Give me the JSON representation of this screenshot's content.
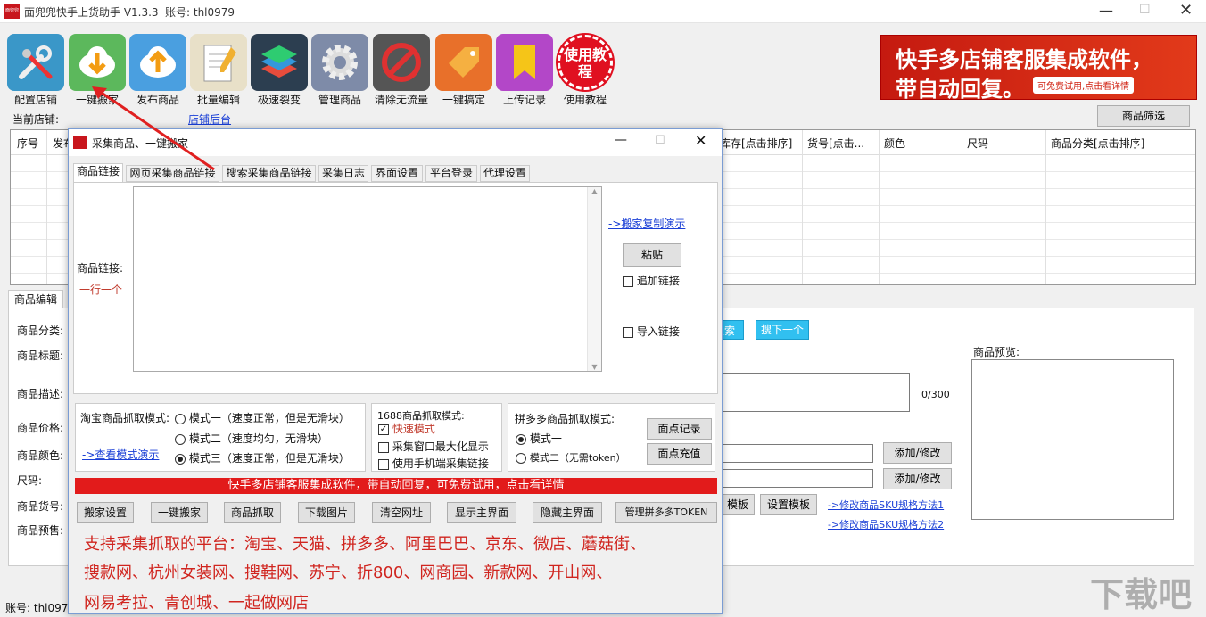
{
  "app": {
    "title": "面兜兜快手上货助手 V1.3.3",
    "account": "账号: thl0979",
    "logo_text": "面兜兜"
  },
  "toolbar": [
    {
      "label": "配置店铺",
      "icon": "tools-icon"
    },
    {
      "label": "一键搬家",
      "icon": "download-cloud-icon"
    },
    {
      "label": "发布商品",
      "icon": "upload-cloud-icon"
    },
    {
      "label": "批量编辑",
      "icon": "notepad-icon"
    },
    {
      "label": "极速裂变",
      "icon": "layers-icon"
    },
    {
      "label": "管理商品",
      "icon": "gear-icon"
    },
    {
      "label": "清除无流量",
      "icon": "forbidden-icon"
    },
    {
      "label": "一键搞定",
      "icon": "tag-icon"
    },
    {
      "label": "上传记录",
      "icon": "bookmark-icon"
    },
    {
      "label": "使用教程",
      "icon": "tutorial-badge-icon",
      "badge": "使用教程"
    }
  ],
  "banner": {
    "line1": "快手多店铺客服集成软件，",
    "line2": "带自动回复。",
    "tag": "可免费试用,点击看详情"
  },
  "main": {
    "current_store_label": "当前店铺:",
    "store_link": "店铺后台",
    "filter_button": "商品筛选",
    "columns_left": [
      "序号",
      "发布"
    ],
    "columns_right": [
      "库存[点击排序]",
      "货号[点击...",
      "颜色",
      "尺码",
      "商品分类[点击排序]"
    ],
    "edit_tab": "商品编辑",
    "fields": [
      "商品分类:",
      "商品标题:",
      "商品描述:",
      "商品价格:",
      "商品颜色:",
      "尺码:",
      "商品货号:",
      "商品预售:"
    ],
    "search_btn": "搜索",
    "next_btn": "搜下一个",
    "counter": "0/300",
    "preview_label": "商品预览:",
    "add_edit_1": "添加/修改",
    "add_edit_2": "添加/修改",
    "template_btn": "模板",
    "set_template_btn": "设置模板",
    "sku_link_1": "->修改商品SKU规格方法1",
    "sku_link_2": "->修改商品SKU规格方法2",
    "status_account": "账号: thl0979"
  },
  "dialog": {
    "title": "采集商品、一键搬家",
    "tabs": [
      "商品链接",
      "网页采集商品链接",
      "搜索采集商品链接",
      "采集日志",
      "界面设置",
      "平台登录",
      "代理设置"
    ],
    "link_label": "商品链接:",
    "link_hint": "一行一个",
    "textarea_value": "",
    "demo_link": "->搬家复制演示",
    "paste_btn": "粘贴",
    "append_cb": "追加链接",
    "import_cb": "导入链接",
    "taobao": {
      "title": "淘宝商品抓取模式:",
      "opt1": "模式一（速度正常，但是无滑块）",
      "opt2": "模式二（速度均匀，无滑块）",
      "opt3": "模式三（速度正常，但是无滑块）",
      "selected": 3,
      "demo": "->查看模式演示"
    },
    "g1688": {
      "title": "1688商品抓取模式:",
      "cb1": "快速模式",
      "cb1_checked": true,
      "cb2": "采集窗口最大化显示",
      "cb3": "使用手机端采集链接"
    },
    "pdd": {
      "title": "拼多多商品抓取模式:",
      "opt1": "模式一",
      "opt2": "模式二（无需token）",
      "selected": 1,
      "btn1": "面点记录",
      "btn2": "面点充值"
    },
    "red_banner": "快手多店铺客服集成软件，带自动回复，可免费试用，点击看详情",
    "buttons": [
      "搬家设置",
      "一键搬家",
      "商品抓取",
      "下载图片",
      "清空网址",
      "显示主界面",
      "隐藏主界面",
      "管理拼多多TOKEN"
    ],
    "platforms": [
      "支持采集抓取的平台：淘宝、天猫、拼多多、阿里巴巴、京东、微店、蘑菇街、",
      "搜款网、杭州女装网、搜鞋网、苏宁、折800、网商园、新款网、开山网、",
      "网易考拉、青创城、一起做网店"
    ]
  },
  "watermark": "下载吧"
}
